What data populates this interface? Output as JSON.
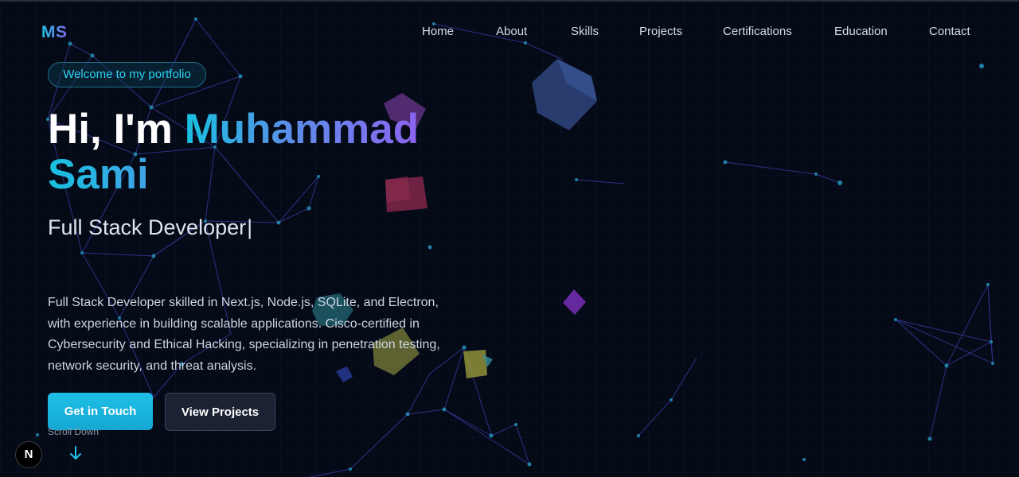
{
  "brand": {
    "logo": "MS"
  },
  "nav": {
    "items": [
      {
        "label": "Home"
      },
      {
        "label": "About"
      },
      {
        "label": "Skills"
      },
      {
        "label": "Projects"
      },
      {
        "label": "Certifications"
      },
      {
        "label": "Education"
      },
      {
        "label": "Contact"
      }
    ]
  },
  "hero": {
    "badge": "Welcome to my portfolio",
    "greeting": "Hi, I'm",
    "first_name": "Muhammad",
    "last_name": "Sami",
    "role": "Full Stack Developer",
    "cursor": "|",
    "description": "Full Stack Developer skilled in Next.js, Node.js, SQLite, and Electron, with experience in building scalable applications. Cisco-certified in Cybersecurity and Ethical Hacking, specializing in penetration testing, network security, and threat analysis.",
    "primary_button": "Get in Touch",
    "secondary_button": "View Projects",
    "scroll_label": "Scroll Down"
  },
  "dev_badge": {
    "letter": "N"
  },
  "colors": {
    "background": "#050a17",
    "accent_cyan": "#1fc0e6",
    "accent_violet": "#8c64ef",
    "button_secondary": "#1a2233"
  },
  "icons": {
    "scroll": "arrow-down-icon"
  }
}
